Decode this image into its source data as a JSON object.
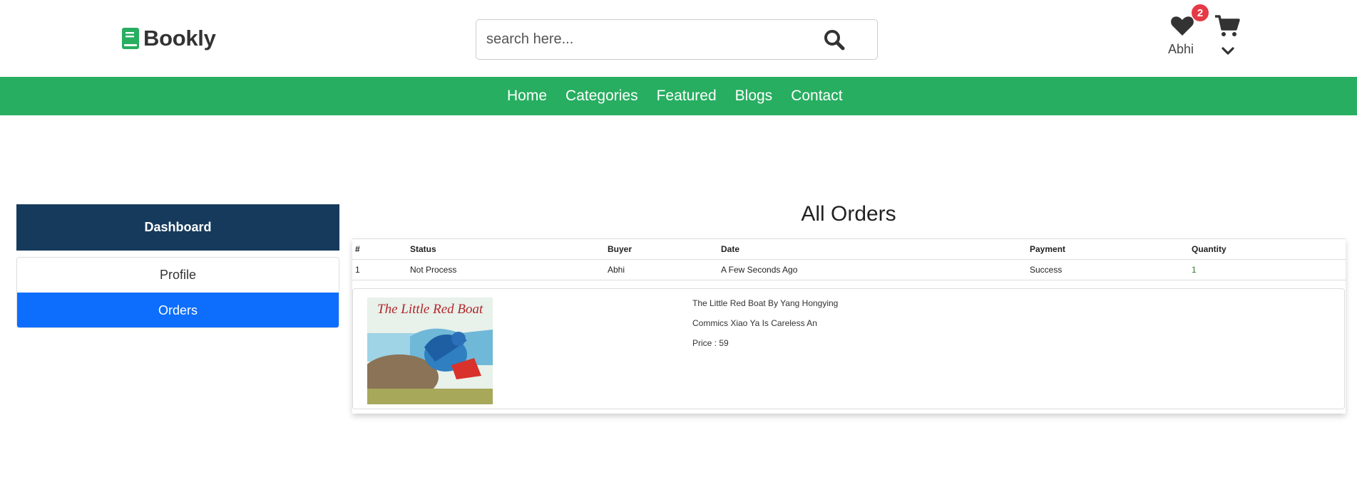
{
  "brand": {
    "name": "Bookly",
    "accent": "#27ae60"
  },
  "search": {
    "placeholder": "search here...",
    "value": ""
  },
  "user": {
    "name": "Abhi",
    "wishlist_count": "2"
  },
  "icons": [
    "book-icon",
    "search-icon",
    "heart-icon",
    "cart-icon",
    "chevron-down-icon"
  ],
  "nav": {
    "items": [
      {
        "label": "Home"
      },
      {
        "label": "Categories"
      },
      {
        "label": "Featured"
      },
      {
        "label": "Blogs"
      },
      {
        "label": "Contact"
      }
    ]
  },
  "sidebar": {
    "title": "Dashboard",
    "items": [
      {
        "label": "Profile",
        "active": false
      },
      {
        "label": "Orders",
        "active": true
      }
    ]
  },
  "main": {
    "title": "All Orders",
    "columns": [
      "#",
      "Status",
      "Buyer",
      "Date",
      "Payment",
      "Quantity"
    ],
    "rows": [
      {
        "num": "1",
        "status": "Not Process",
        "buyer": "Abhi",
        "date": "A Few Seconds Ago",
        "payment": "Success",
        "quantity": "1"
      }
    ],
    "product": {
      "cover_title": "The Little Red Boat",
      "name": "The Little Red Boat By Yang Hongying",
      "description": "Commics Xiao Ya Is Careless An",
      "price": "Price : 59"
    }
  }
}
